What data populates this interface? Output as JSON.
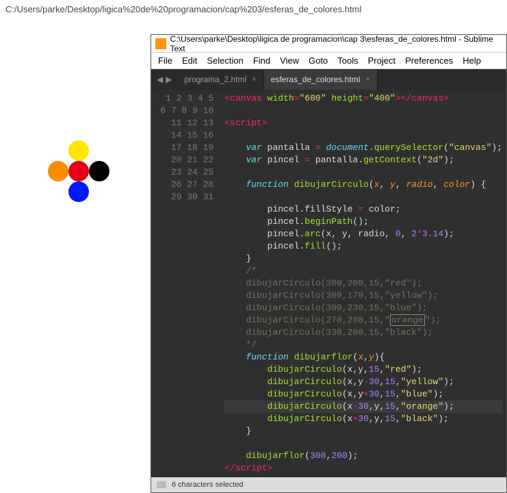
{
  "address_bar": "C:/Users/parke/Desktop/ligica%20de%20programacion/cap%203/esferas_de_colores.html",
  "sublime": {
    "title": "C:\\Users\\parke\\Desktop\\ligica de programacion\\cap 3\\esferas_de_colores.html - Sublime Text",
    "menus": [
      "File",
      "Edit",
      "Selection",
      "Find",
      "View",
      "Goto",
      "Tools",
      "Project",
      "Preferences",
      "Help"
    ],
    "tabs": [
      {
        "label": "programa_2.html",
        "active": false
      },
      {
        "label": "esferas_de_colores.html",
        "active": true
      }
    ],
    "status": "6 characters selected",
    "lines_count": 31
  },
  "code_tokens": [
    [
      [
        "<",
        "tk-tag"
      ],
      [
        "canvas",
        "tk-tag"
      ],
      [
        " "
      ],
      [
        "width",
        "tk-attr"
      ],
      [
        "=",
        "tk-op"
      ],
      [
        "\"600\"",
        "tk-str"
      ],
      [
        " "
      ],
      [
        "height",
        "tk-attr"
      ],
      [
        "=",
        "tk-op"
      ],
      [
        "\"400\"",
        "tk-str"
      ],
      [
        "></",
        "tk-tag"
      ],
      [
        "canvas",
        "tk-tag"
      ],
      [
        ">",
        "tk-tag"
      ]
    ],
    [],
    [
      [
        "<",
        "tk-tag"
      ],
      [
        "script",
        "tk-tag"
      ],
      [
        ">",
        "tk-tag"
      ]
    ],
    [],
    [
      [
        "    "
      ],
      [
        "var",
        "tk-stor"
      ],
      [
        " pantalla "
      ],
      [
        "=",
        "tk-op"
      ],
      [
        " "
      ],
      [
        "document",
        "tk-obj"
      ],
      [
        "."
      ],
      [
        "querySelector",
        "tk-func"
      ],
      [
        "("
      ],
      [
        "\"canvas\"",
        "tk-str"
      ],
      [
        ");"
      ]
    ],
    [
      [
        "    "
      ],
      [
        "var",
        "tk-stor"
      ],
      [
        " pincel "
      ],
      [
        "=",
        "tk-op"
      ],
      [
        " pantalla."
      ],
      [
        "getContext",
        "tk-func"
      ],
      [
        "("
      ],
      [
        "\"2d\"",
        "tk-str"
      ],
      [
        ");"
      ]
    ],
    [],
    [
      [
        "    "
      ],
      [
        "function",
        "tk-stor"
      ],
      [
        " "
      ],
      [
        "dibujarCirculo",
        "tk-func"
      ],
      [
        "("
      ],
      [
        "x",
        "tk-param"
      ],
      [
        ", "
      ],
      [
        "y",
        "tk-param"
      ],
      [
        ", "
      ],
      [
        "radio",
        "tk-param"
      ],
      [
        ", "
      ],
      [
        "color",
        "tk-param"
      ],
      [
        ") {"
      ]
    ],
    [],
    [
      [
        "        pincel.fillStyle "
      ],
      [
        "=",
        "tk-op"
      ],
      [
        " color;"
      ]
    ],
    [
      [
        "        pincel."
      ],
      [
        "beginPath",
        "tk-func"
      ],
      [
        "();"
      ]
    ],
    [
      [
        "        pincel."
      ],
      [
        "arc",
        "tk-func"
      ],
      [
        "(x, y, radio, "
      ],
      [
        "0",
        "tk-num"
      ],
      [
        ", "
      ],
      [
        "2",
        "tk-num"
      ],
      [
        "*",
        "tk-op"
      ],
      [
        "3.14",
        "tk-num"
      ],
      [
        ");"
      ]
    ],
    [
      [
        "        pincel."
      ],
      [
        "fill",
        "tk-func"
      ],
      [
        "();"
      ]
    ],
    [
      [
        "    }"
      ]
    ],
    [
      [
        "    "
      ],
      [
        "/*",
        "tk-comm"
      ]
    ],
    [
      [
        "    dibujarCirculo(300,200,15,\"red\");",
        "tk-comm"
      ]
    ],
    [
      [
        "    dibujarCirculo(300,170,15,\"yellow\");",
        "tk-comm"
      ]
    ],
    [
      [
        "    dibujarCirculo(300,230,15,\"blue\");",
        "tk-comm"
      ]
    ],
    [
      [
        "    dibujarCirculo(270,200,15,\"",
        "tk-comm"
      ],
      [
        "orange",
        "tk-comm sel-box"
      ],
      [
        "\");",
        "tk-comm"
      ]
    ],
    [
      [
        "    dibujarCirculo(330,200,15,\"black\");",
        "tk-comm"
      ]
    ],
    [
      [
        "    */",
        "tk-comm"
      ]
    ],
    [
      [
        "    "
      ],
      [
        "function",
        "tk-stor"
      ],
      [
        " "
      ],
      [
        "dibujarflor",
        "tk-func"
      ],
      [
        "("
      ],
      [
        "x",
        "tk-param"
      ],
      [
        ","
      ],
      [
        "y",
        "tk-param"
      ],
      [
        "){"
      ]
    ],
    [
      [
        "        "
      ],
      [
        "dibujarCirculo",
        "tk-func"
      ],
      [
        "(x,y,"
      ],
      [
        "15",
        "tk-num"
      ],
      [
        ","
      ],
      [
        "\"red\"",
        "tk-str"
      ],
      [
        ");"
      ]
    ],
    [
      [
        "        "
      ],
      [
        "dibujarCirculo",
        "tk-func"
      ],
      [
        "(x,y"
      ],
      [
        "-",
        "tk-op"
      ],
      [
        "30",
        "tk-num"
      ],
      [
        ","
      ],
      [
        "15",
        "tk-num"
      ],
      [
        ","
      ],
      [
        "\"yellow\"",
        "tk-str"
      ],
      [
        ");"
      ]
    ],
    [
      [
        "        "
      ],
      [
        "dibujarCirculo",
        "tk-func"
      ],
      [
        "(x,y"
      ],
      [
        "+",
        "tk-op"
      ],
      [
        "30",
        "tk-num"
      ],
      [
        ","
      ],
      [
        "15",
        "tk-num"
      ],
      [
        ","
      ],
      [
        "\"blue\"",
        "tk-str"
      ],
      [
        ");"
      ]
    ],
    [
      [
        "        "
      ],
      [
        "dibujarCirculo",
        "tk-func"
      ],
      [
        "(x"
      ],
      [
        "-",
        "tk-op"
      ],
      [
        "30",
        "tk-num"
      ],
      [
        ",y,"
      ],
      [
        "15",
        "tk-num"
      ],
      [
        ","
      ],
      [
        "\"orange\"",
        "tk-str"
      ],
      [
        ");"
      ]
    ],
    [
      [
        "        "
      ],
      [
        "dibujarCirculo",
        "tk-func"
      ],
      [
        "(x"
      ],
      [
        "+",
        "tk-op"
      ],
      [
        "30",
        "tk-num"
      ],
      [
        ",y,"
      ],
      [
        "15",
        "tk-num"
      ],
      [
        ","
      ],
      [
        "\"black\"",
        "tk-str"
      ],
      [
        ");"
      ]
    ],
    [
      [
        "    }"
      ]
    ],
    [],
    [
      [
        "    "
      ],
      [
        "dibujarflor",
        "tk-func"
      ],
      [
        "("
      ],
      [
        "300",
        "tk-num"
      ],
      [
        ","
      ],
      [
        "200",
        "tk-num"
      ],
      [
        ");"
      ]
    ],
    [
      [
        "</",
        "tk-tag"
      ],
      [
        "script",
        "tk-tag"
      ],
      [
        ">",
        "tk-tag"
      ]
    ]
  ],
  "highlight_line": 26
}
